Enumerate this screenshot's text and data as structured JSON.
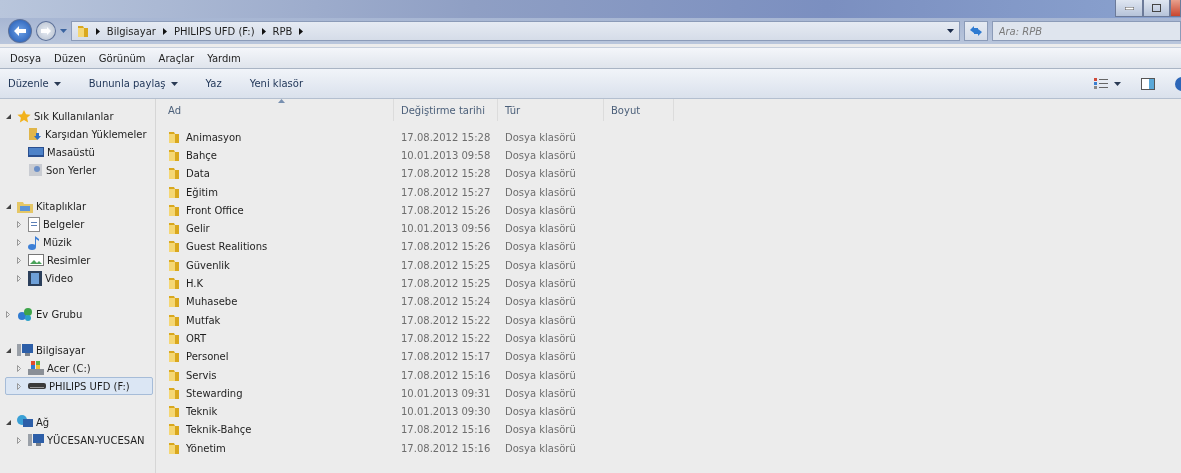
{
  "address": {
    "crumbs": [
      "Bilgisayar",
      "PHILIPS UFD (F:)",
      "RPB"
    ],
    "search_placeholder": "Ara: RPB"
  },
  "menu": [
    "Dosya",
    "Düzen",
    "Görünüm",
    "Araçlar",
    "Yardım"
  ],
  "commands": [
    {
      "label": "Düzenle",
      "dropdown": true
    },
    {
      "label": "Bununla paylaş",
      "dropdown": true
    },
    {
      "label": "Yaz",
      "dropdown": false
    },
    {
      "label": "Yeni klasör",
      "dropdown": false
    }
  ],
  "sidebar": {
    "sections": [
      {
        "label": "Sık Kullanılanlar",
        "kind": "favorites",
        "expanded": true,
        "selected": false,
        "children": [
          {
            "label": "Karşıdan Yüklemeler",
            "kind": "downloads",
            "selected": false
          },
          {
            "label": "Masaüstü",
            "kind": "desktop",
            "selected": false
          },
          {
            "label": "Son Yerler",
            "kind": "recent",
            "selected": false
          }
        ]
      },
      {
        "label": "Kitaplıklar",
        "kind": "library",
        "expanded": true,
        "selected": false,
        "children": [
          {
            "label": "Belgeler",
            "kind": "documents",
            "expanded": false,
            "selected": false
          },
          {
            "label": "Müzik",
            "kind": "music",
            "expanded": false,
            "selected": false
          },
          {
            "label": "Resimler",
            "kind": "pictures",
            "expanded": false,
            "selected": false
          },
          {
            "label": "Video",
            "kind": "video",
            "expanded": false,
            "selected": false
          }
        ]
      },
      {
        "label": "Ev Grubu",
        "kind": "homegroup",
        "expanded": false,
        "selected": false
      },
      {
        "label": "Bilgisayar",
        "kind": "computer",
        "expanded": true,
        "selected": false,
        "children": [
          {
            "label": "Acer (C:)",
            "kind": "disk",
            "expanded": false,
            "selected": false
          },
          {
            "label": "PHILIPS UFD (F:)",
            "kind": "usb",
            "expanded": false,
            "selected": true
          }
        ]
      },
      {
        "label": "Ağ",
        "kind": "network",
        "expanded": true,
        "selected": false,
        "children": [
          {
            "label": "YÜCESAN-YUCESAN",
            "kind": "computer",
            "expanded": false,
            "selected": false
          }
        ]
      }
    ]
  },
  "table": {
    "columns": [
      "Ad",
      "Değiştirme tarihi",
      "Tür",
      "Boyut"
    ],
    "rows": [
      [
        "Animasyon",
        "17.08.2012 15:28",
        "Dosya klasörü"
      ],
      [
        "Bahçe",
        "10.01.2013 09:58",
        "Dosya klasörü"
      ],
      [
        "Data",
        "17.08.2012 15:28",
        "Dosya klasörü"
      ],
      [
        "Eğitim",
        "17.08.2012 15:27",
        "Dosya klasörü"
      ],
      [
        "Front Office",
        "17.08.2012 15:26",
        "Dosya klasörü"
      ],
      [
        "Gelir",
        "10.01.2013 09:56",
        "Dosya klasörü"
      ],
      [
        "Guest Realitions",
        "17.08.2012 15:26",
        "Dosya klasörü"
      ],
      [
        "Güvenlik",
        "17.08.2012 15:25",
        "Dosya klasörü"
      ],
      [
        "H.K",
        "17.08.2012 15:25",
        "Dosya klasörü"
      ],
      [
        "Muhasebe",
        "17.08.2012 15:24",
        "Dosya klasörü"
      ],
      [
        "Mutfak",
        "17.08.2012 15:22",
        "Dosya klasörü"
      ],
      [
        "ORT",
        "17.08.2012 15:22",
        "Dosya klasörü"
      ],
      [
        "Personel",
        "17.08.2012 15:17",
        "Dosya klasörü"
      ],
      [
        "Servis",
        "17.08.2012 15:16",
        "Dosya klasörü"
      ],
      [
        "Stewarding",
        "10.01.2013 09:31",
        "Dosya klasörü"
      ],
      [
        "Teknik",
        "10.01.2013 09:30",
        "Dosya klasörü"
      ],
      [
        "Teknik-Bahçe",
        "17.08.2012 15:16",
        "Dosya klasörü"
      ],
      [
        "Yönetim",
        "17.08.2012 15:16",
        "Dosya klasörü"
      ]
    ]
  }
}
